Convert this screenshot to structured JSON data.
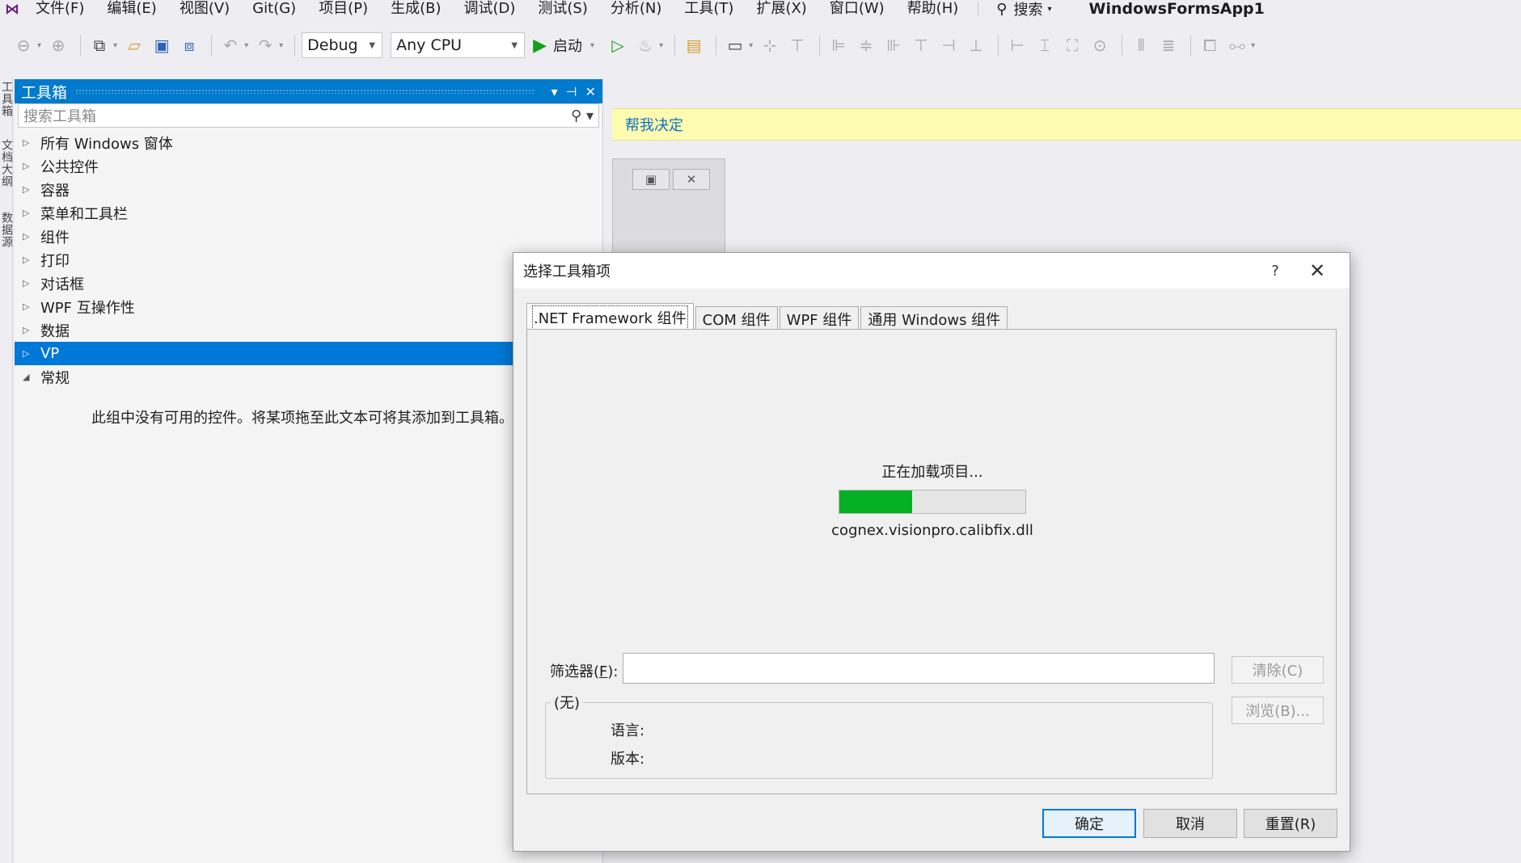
{
  "menubar": {
    "items": [
      "文件(F)",
      "编辑(E)",
      "视图(V)",
      "Git(G)",
      "项目(P)",
      "生成(B)",
      "调试(D)",
      "测试(S)",
      "分析(N)",
      "工具(T)",
      "扩展(X)",
      "窗口(W)",
      "帮助(H)"
    ],
    "search_label": "搜索",
    "solution_title": "WindowsFormsApp1"
  },
  "toolbar": {
    "config": "Debug",
    "platform": "Any CPU",
    "start_label": "启动"
  },
  "side_tabs": [
    "工具箱",
    "文档大纲",
    "数据源"
  ],
  "toolbox": {
    "title": "工具箱",
    "search_placeholder": "搜索工具箱",
    "items": [
      {
        "label": "所有 Windows 窗体",
        "expanded": false,
        "selected": false
      },
      {
        "label": "公共控件",
        "expanded": false,
        "selected": false
      },
      {
        "label": "容器",
        "expanded": false,
        "selected": false
      },
      {
        "label": "菜单和工具栏",
        "expanded": false,
        "selected": false
      },
      {
        "label": "组件",
        "expanded": false,
        "selected": false
      },
      {
        "label": "打印",
        "expanded": false,
        "selected": false
      },
      {
        "label": "对话框",
        "expanded": false,
        "selected": false
      },
      {
        "label": "WPF 互操作性",
        "expanded": false,
        "selected": false
      },
      {
        "label": "数据",
        "expanded": false,
        "selected": false
      },
      {
        "label": "VP",
        "expanded": false,
        "selected": true
      },
      {
        "label": "常规",
        "expanded": true,
        "selected": false
      }
    ],
    "empty_message": "此组中没有可用的控件。将某项拖至此文本可将其添加到工具箱。"
  },
  "designer": {
    "infobar_link": "帮我决定"
  },
  "dialog": {
    "title": "选择工具箱项",
    "help_label": "?",
    "tabs": [
      {
        "label": ".NET Framework 组件",
        "active": true
      },
      {
        "label": "COM 组件",
        "active": false
      },
      {
        "label": "WPF 组件",
        "active": false
      },
      {
        "label": "通用 Windows 组件",
        "active": false
      }
    ],
    "loading_text": "正在加载项目...",
    "progress_fraction": 0.39,
    "loading_file": "cognex.visionpro.calibfix.dll",
    "filter_label_prefix": "筛选器(",
    "filter_label_key": "F",
    "filter_label_suffix": "):",
    "filter_value": "",
    "clear_label": "清除(C)",
    "browse_label": "浏览(B)...",
    "group_legend": "(无)",
    "language_label": "语言:",
    "version_label": "版本:",
    "ok_label": "确定",
    "cancel_label": "取消",
    "reset_label": "重置(R)"
  },
  "colors": {
    "accent": "#007acc",
    "selection": "#0078d7",
    "progress": "#06b025",
    "infobar": "#fdfbb0"
  }
}
